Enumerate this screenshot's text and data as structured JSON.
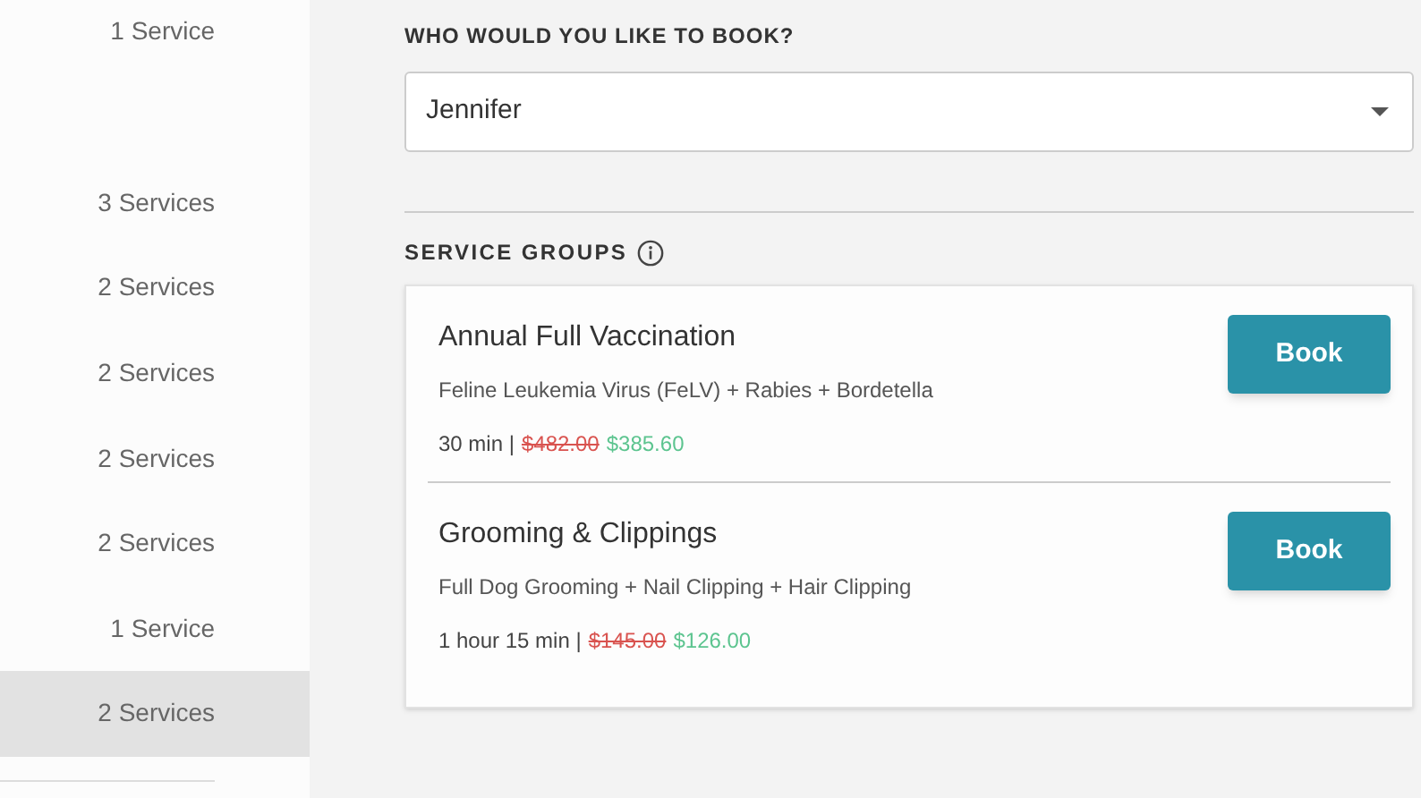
{
  "sidebar": {
    "top_item": {
      "count": "1 Service",
      "selected": false
    },
    "items": [
      {
        "count": "3 Services",
        "selected": false
      },
      {
        "count": "2 Services",
        "selected": false
      },
      {
        "count": "2 Services",
        "selected": false
      },
      {
        "count": "2 Services",
        "selected": false
      },
      {
        "count": "2 Services",
        "selected": false
      },
      {
        "count": "1 Service",
        "selected": false
      },
      {
        "count": "2 Services",
        "selected": true
      }
    ]
  },
  "booking": {
    "label": "WHO WOULD YOU LIKE TO BOOK?",
    "value": "Jennifer"
  },
  "service_groups": {
    "heading": "SERVICE GROUPS",
    "groups": [
      {
        "name": "Annual Full Vaccination",
        "services": "Feline Leukemia Virus (FeLV) + Rabies + Bordetella",
        "duration": "30 min |",
        "old_price": "$482.00",
        "price": "$385.60",
        "button": "Book"
      },
      {
        "name": "Grooming & Clippings",
        "services": "Full Dog Grooming + Nail Clipping + Hair Clipping",
        "duration": "1 hour 15 min |",
        "old_price": "$145.00",
        "price": "$126.00",
        "button": "Book"
      }
    ]
  }
}
